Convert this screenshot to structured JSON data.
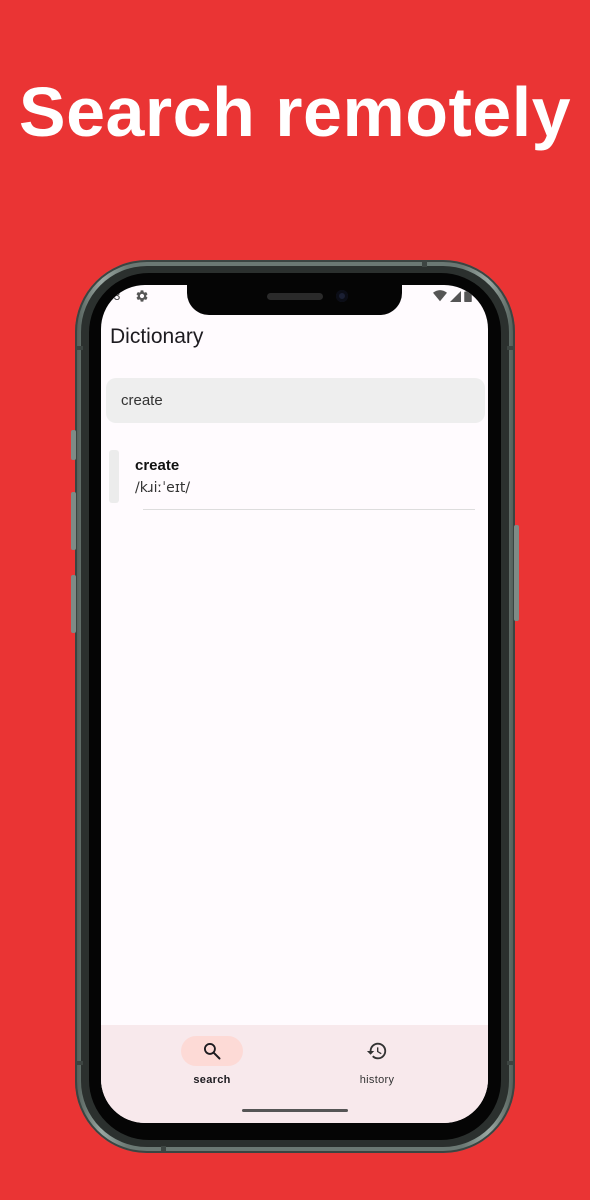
{
  "headline": "Search remotely",
  "status_bar": {
    "time": "53",
    "icons": [
      "settings-gear-icon",
      "wifi-icon",
      "cell-signal-icon",
      "battery-icon"
    ]
  },
  "app": {
    "title": "Dictionary",
    "search": {
      "value": "create"
    },
    "results": [
      {
        "word": "create",
        "phonetic": "/kɹiːˈeɪt/"
      }
    ],
    "bottom_nav": [
      {
        "label": "search",
        "icon": "search-icon",
        "selected": true
      },
      {
        "label": "history",
        "icon": "history-icon",
        "selected": false
      }
    ]
  },
  "colors": {
    "background": "#EA3434",
    "screen": "#FFFBFE",
    "nav_background": "#F8E9EC",
    "nav_selected_pill": "#FDDAD6"
  }
}
